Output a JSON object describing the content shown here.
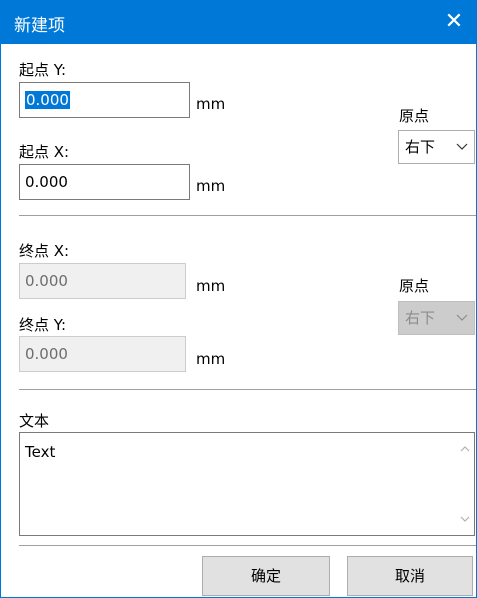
{
  "dialog": {
    "title": "新建项",
    "close_glyph": "✕"
  },
  "start": {
    "y_label": "起点 Y:",
    "y_value": "0.000",
    "x_label": "起点 X:",
    "x_value": "0.000",
    "unit": "mm",
    "origin_label": "原点",
    "origin_value": "右下"
  },
  "end": {
    "x_label": "终点 X:",
    "x_value": "0.000",
    "y_label": "终点 Y:",
    "y_value": "0.000",
    "unit": "mm",
    "origin_label": "原点",
    "origin_value": "右下"
  },
  "text": {
    "label": "文本",
    "value": "Text"
  },
  "buttons": {
    "ok": "确定",
    "cancel": "取消"
  },
  "icons": {
    "close": "close-icon",
    "chevron": "chevron-down-icon",
    "scroll_up": "scroll-up-arrow-icon",
    "scroll_down": "scroll-down-arrow-icon"
  },
  "colors": {
    "accent": "#0078d7",
    "button_face": "#e1e1e1",
    "disabled_field": "#f0f0f0"
  }
}
